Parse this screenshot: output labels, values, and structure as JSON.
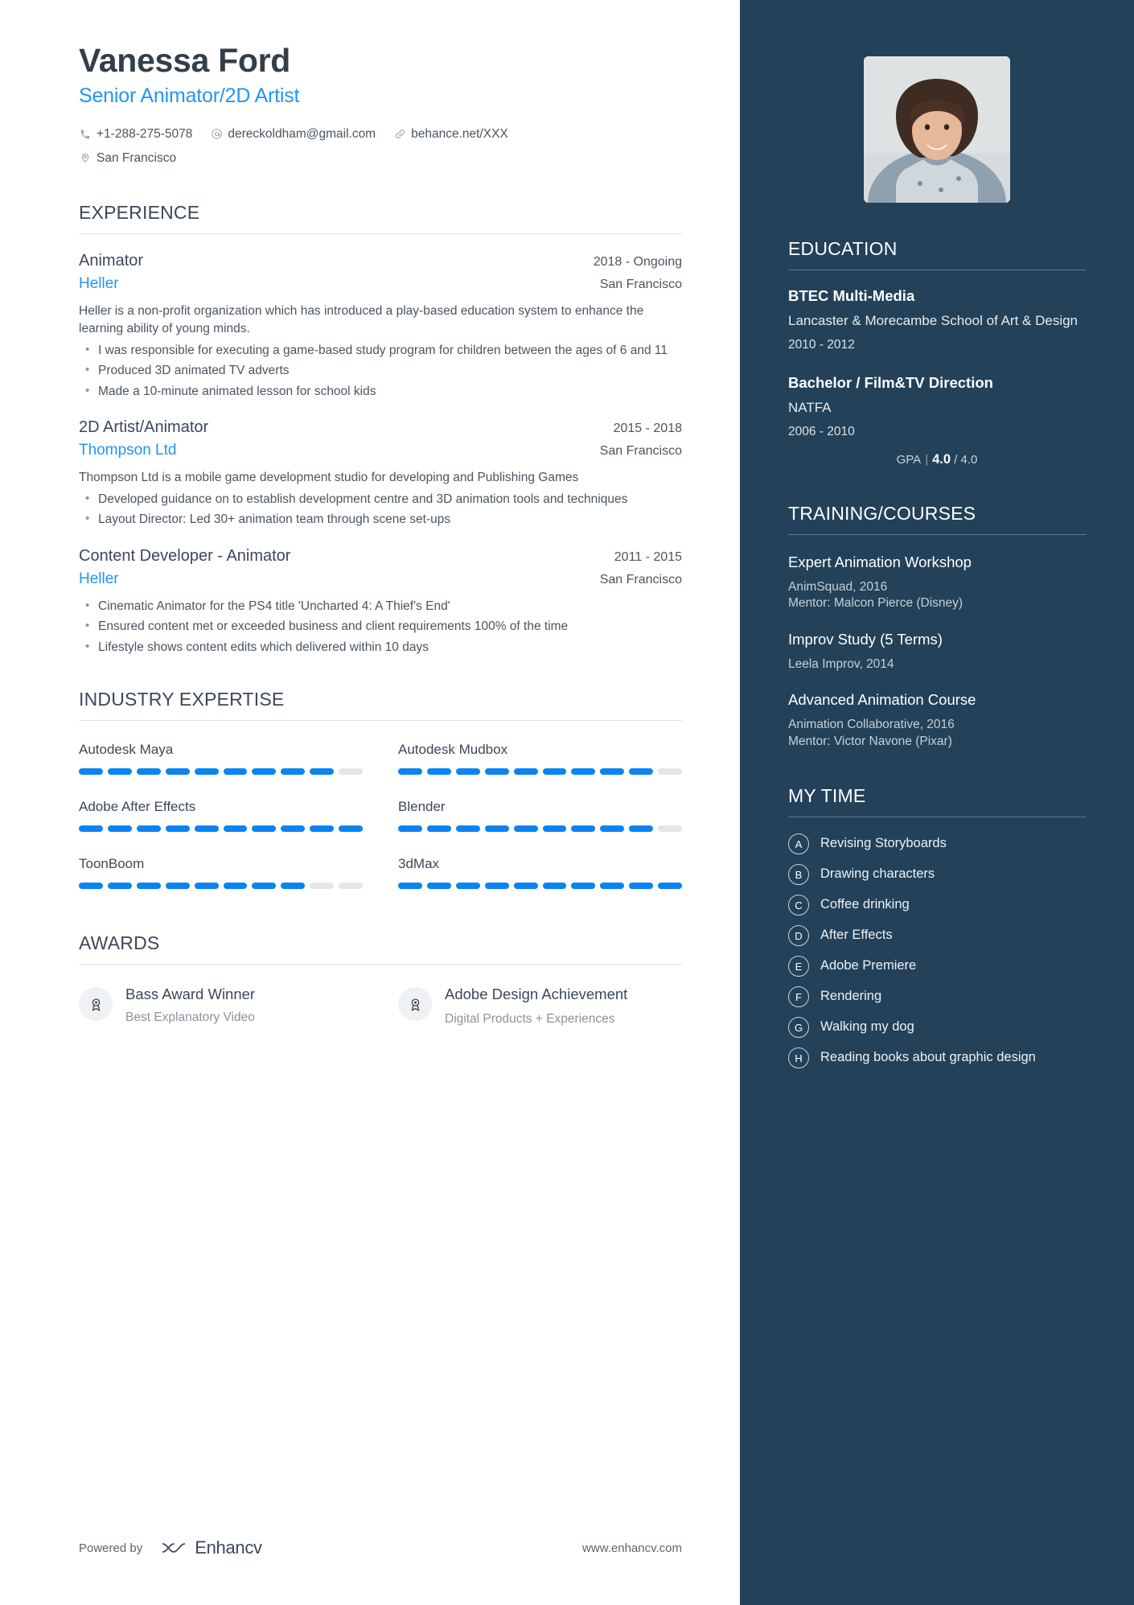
{
  "header": {
    "name": "Vanessa Ford",
    "headline": "Senior Animator/2D Artist",
    "contacts": [
      {
        "icon": "phone-icon",
        "text": "+1-288-275-5078"
      },
      {
        "icon": "email-icon",
        "text": "dereckoldham@gmail.com"
      },
      {
        "icon": "link-icon",
        "text": "behance.net/XXX"
      },
      {
        "icon": "location-icon",
        "text": "San Francisco"
      }
    ]
  },
  "experience": {
    "title": "EXPERIENCE",
    "jobs": [
      {
        "title": "Animator",
        "date": "2018 - Ongoing",
        "company": "Heller",
        "location": "San Francisco",
        "description": "Heller is a non-profit organization which has introduced a play-based education system to enhance the learning ability of young minds.",
        "bullets": [
          "I was responsible for executing a game-based study program for children between the ages of 6 and 11",
          "Produced 3D animated TV adverts",
          "Made a 10-minute animated lesson for school kids"
        ]
      },
      {
        "title": "2D Artist/Animator",
        "date": "2015 - 2018",
        "company": "Thompson Ltd",
        "location": "San Francisco",
        "description": "Thompson Ltd is a mobile game development studio for developing and Publishing Games",
        "bullets": [
          "Developed guidance on to establish development centre and 3D animation tools and techniques",
          "Layout Director: Led 30+ animation team through scene set-ups"
        ]
      },
      {
        "title": "Content Developer - Animator",
        "date": "2011 - 2015",
        "company": "Heller",
        "location": "San Francisco",
        "description": "",
        "bullets": [
          "Cinematic Animator for the PS4 title 'Uncharted 4: A Thief's End'",
          "Ensured content met or exceeded business and client requirements 100% of the time",
          "Lifestyle shows content edits which delivered within 10 days"
        ]
      }
    ]
  },
  "expertise": {
    "title": "INDUSTRY EXPERTISE",
    "total_segments": 10,
    "skills": [
      {
        "name": "Autodesk Maya",
        "filled": 9
      },
      {
        "name": "Autodesk Mudbox",
        "filled": 9
      },
      {
        "name": "Adobe After Effects",
        "filled": 10
      },
      {
        "name": "Blender",
        "filled": 9
      },
      {
        "name": "ToonBoom",
        "filled": 8
      },
      {
        "name": "3dMax",
        "filled": 10
      }
    ]
  },
  "awards": {
    "title": "AWARDS",
    "items": [
      {
        "icon": "award-badge-icon",
        "title": "Bass Award Winner",
        "subtitle": "Best Explanatory Video"
      },
      {
        "icon": "award-badge-icon",
        "title": "Adobe Design Achievement",
        "subtitle": "Digital Products + Experiences"
      }
    ]
  },
  "footer": {
    "powered_by": "Powered by",
    "brand": "Enhancv",
    "site": "www.enhancv.com"
  },
  "sidebar": {
    "photo_alt": "profile-photo",
    "education": {
      "title": "EDUCATION",
      "entries": [
        {
          "degree": "BTEC Multi-Media",
          "school": "Lancaster & Morecambe School of Art & Design",
          "years": "2010 - 2012"
        },
        {
          "degree": "Bachelor / Film&TV Direction",
          "school": "NATFA",
          "years": "2006 - 2010"
        }
      ],
      "gpa_label": "GPA",
      "gpa_value": "4.0",
      "gpa_scale": "/ 4.0"
    },
    "training": {
      "title": "TRAINING/COURSES",
      "items": [
        {
          "name": "Expert Animation Workshop",
          "meta": "AnimSquad, 2016\nMentor: Malcon Pierce (Disney)"
        },
        {
          "name": "Improv Study (5 Terms)",
          "meta": "Leela Improv, 2014"
        },
        {
          "name": "Advanced Animation Course",
          "meta": "Animation Collaborative, 2016\nMentor: Victor Navone (Pixar)"
        }
      ]
    },
    "my_time": {
      "title": "MY TIME",
      "items": [
        {
          "letter": "A",
          "label": "Revising Storyboards"
        },
        {
          "letter": "B",
          "label": "Drawing characters"
        },
        {
          "letter": "C",
          "label": "Coffee drinking"
        },
        {
          "letter": "D",
          "label": "After Effects"
        },
        {
          "letter": "E",
          "label": "Adobe Premiere"
        },
        {
          "letter": "F",
          "label": "Rendering"
        },
        {
          "letter": "G",
          "label": "Walking my dog"
        },
        {
          "letter": "H",
          "label": "Reading books about graphic design"
        }
      ]
    }
  },
  "colors": {
    "accent": "#2196f3",
    "sidebar": "#234158",
    "bar_on": "#0a84f0",
    "bar_off": "#e4e6e8"
  }
}
